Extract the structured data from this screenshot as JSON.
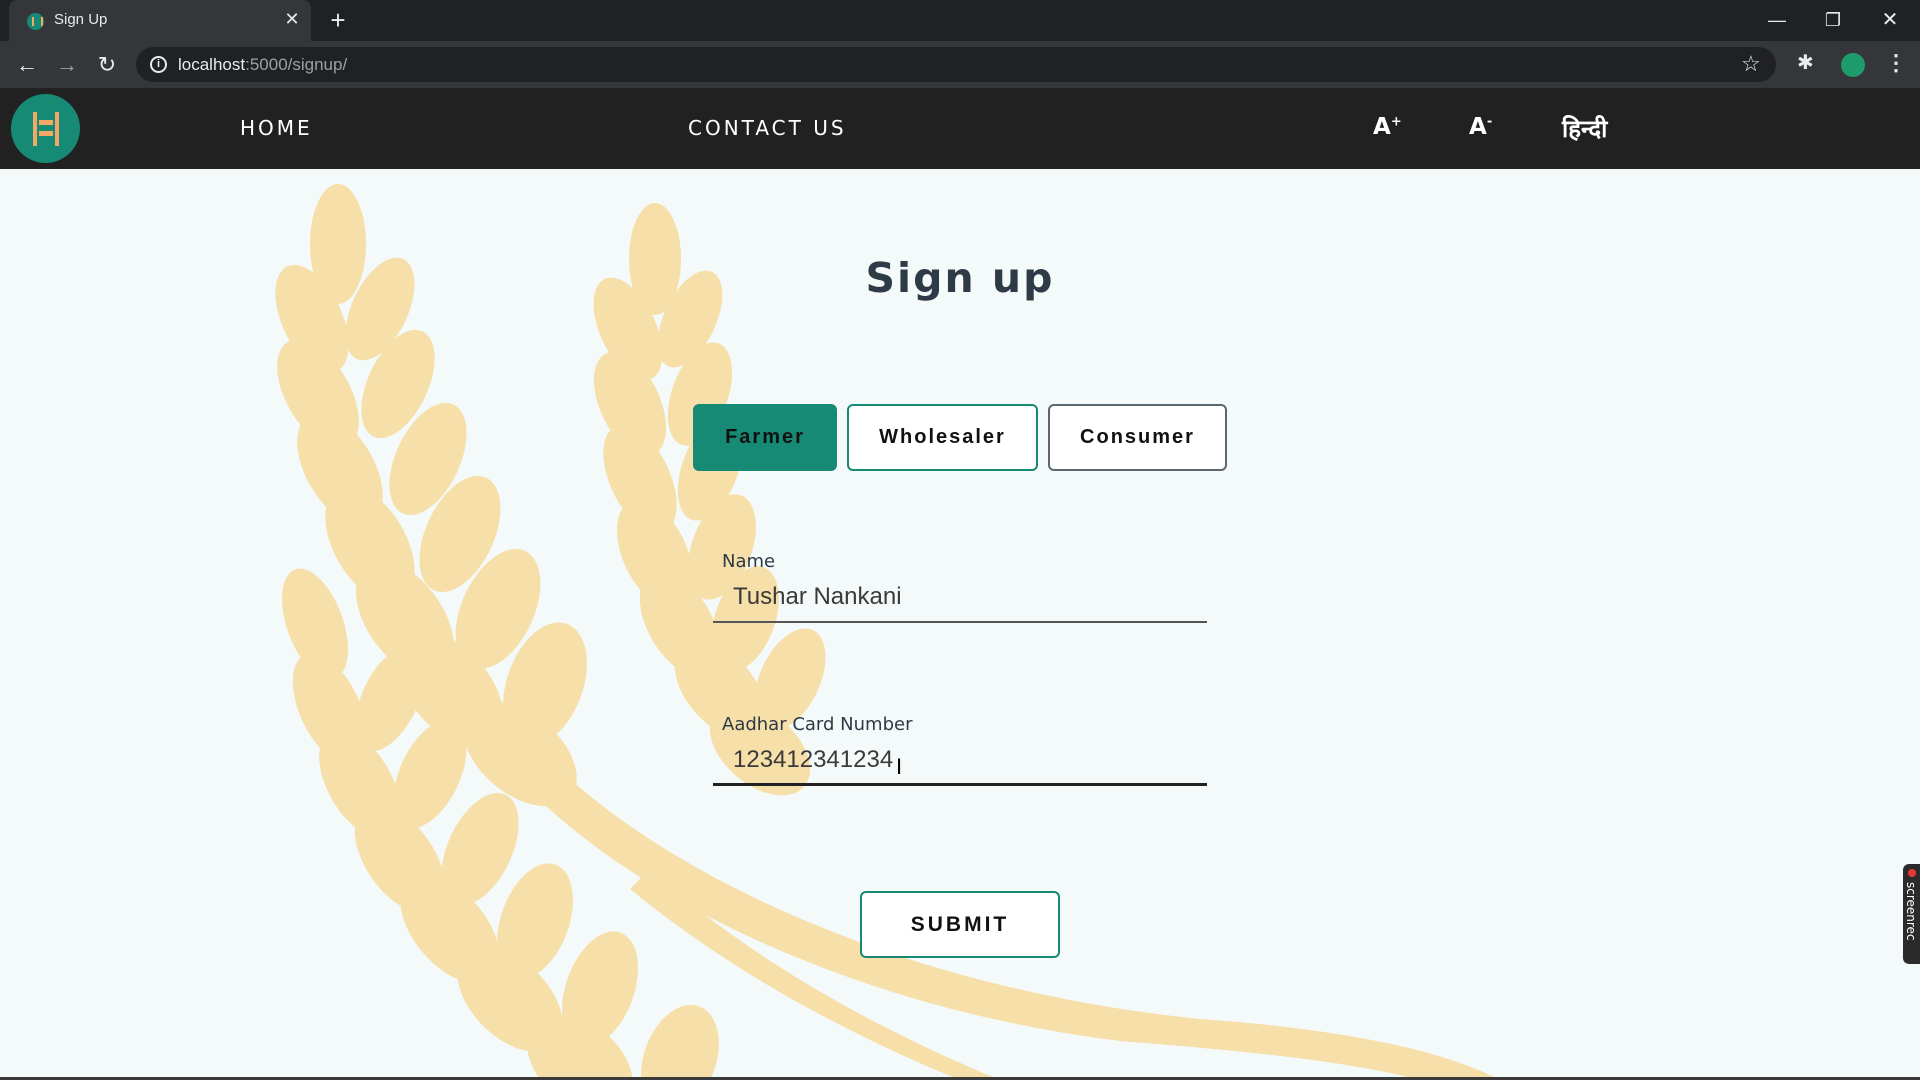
{
  "browser": {
    "tab_title": "Sign Up",
    "tab_close": "✕",
    "new_tab": "+",
    "url_host": "localhost",
    "url_path": ":5000/signup/",
    "window_minimize": "—",
    "window_restore": "❐",
    "window_close": "✕"
  },
  "site_nav": {
    "home": "HOME",
    "contact": "CONTACT US",
    "font_increase_base": "A",
    "font_increase_sup": "+",
    "font_decrease_base": "A",
    "font_decrease_sup": "-",
    "language": "हिन्दी"
  },
  "page": {
    "title": "Sign up",
    "roles": [
      {
        "label": "Farmer",
        "selected": true
      },
      {
        "label": "Wholesaler",
        "selected": false
      },
      {
        "label": "Consumer",
        "selected": false
      }
    ],
    "name_label": "Name",
    "name_value": "Tushar Nankani",
    "aadhar_label": "Aadhar Card Number",
    "aadhar_value": "123412341234",
    "submit": "SUBMIT"
  },
  "colors": {
    "accent": "#168a74",
    "nav_bg": "#212121",
    "page_bg": "#f4f9fa",
    "wheat": "#f6dfa8"
  },
  "overlay": {
    "recorder_label": "screenrec"
  }
}
